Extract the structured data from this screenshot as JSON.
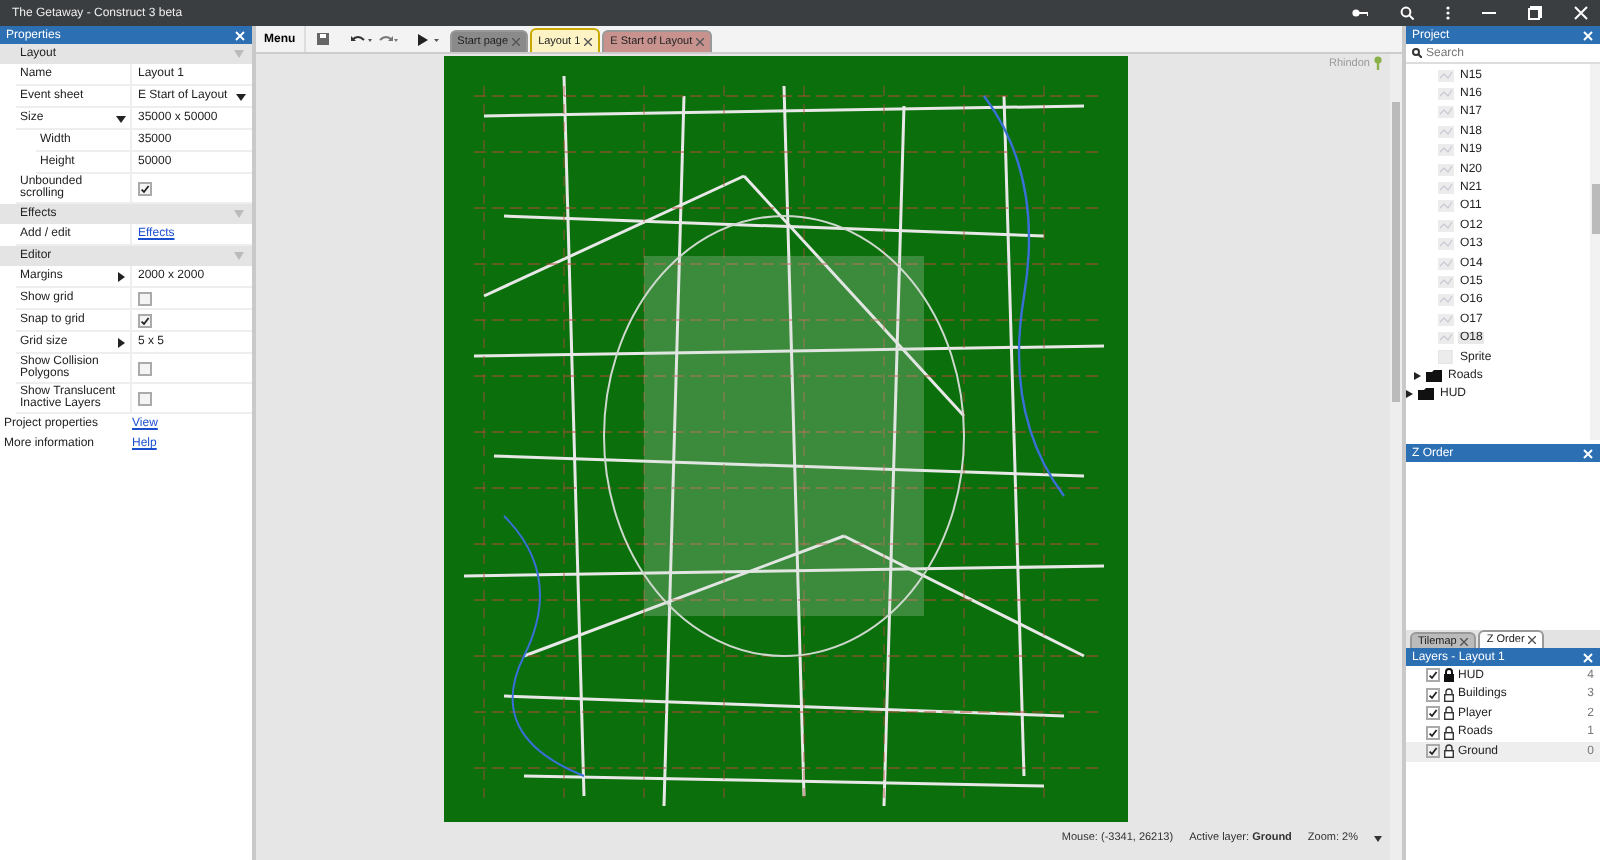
{
  "window": {
    "title": "The Getaway - Construct 3 beta"
  },
  "properties": {
    "title": "Properties",
    "sections": [
      {
        "title": "Layout",
        "rows": [
          {
            "label": "Name",
            "kind": "text",
            "value": "Layout 1"
          },
          {
            "label": "Event sheet",
            "kind": "dropdown",
            "value": "E Start of Layout"
          },
          {
            "label": "Size",
            "kind": "group",
            "value": "35000 x 50000",
            "expanded": true,
            "children": [
              {
                "label": "Width",
                "kind": "text",
                "value": "35000"
              },
              {
                "label": "Height",
                "kind": "text",
                "value": "50000"
              }
            ]
          },
          {
            "label": "Unbounded scrolling",
            "kind": "check",
            "checked": true
          }
        ]
      },
      {
        "title": "Effects",
        "rows": [
          {
            "label": "Add / edit",
            "kind": "link",
            "value": "Effects"
          }
        ]
      },
      {
        "title": "Editor",
        "rows": [
          {
            "label": "Margins",
            "kind": "group",
            "value": "2000 x 2000",
            "expanded": false
          },
          {
            "label": "Show grid",
            "kind": "check",
            "checked": false
          },
          {
            "label": "Snap to grid",
            "kind": "check",
            "checked": true
          },
          {
            "label": "Grid size",
            "kind": "group",
            "value": "5 x 5",
            "expanded": false
          },
          {
            "label": "Show Collision Polygons",
            "kind": "check",
            "checked": false
          },
          {
            "label": "Show Translucent Inactive Layers",
            "kind": "check",
            "checked": false
          }
        ]
      }
    ],
    "footer": [
      {
        "label": "Project properties",
        "link": "View"
      },
      {
        "label": "More information",
        "link": "Help"
      }
    ]
  },
  "toolbar": {
    "menu": "Menu"
  },
  "tabs": [
    {
      "label": "Start page",
      "selected": false,
      "color": "#8a8a8a"
    },
    {
      "label": "Layout 1",
      "selected": true,
      "color": "#fdf3c4"
    },
    {
      "label": "E Start of Layout",
      "selected": false,
      "color": "#c8938f"
    }
  ],
  "user": {
    "name": "Rhindon"
  },
  "status_bar": {
    "mouse": "Mouse: (-3341, 26213)",
    "layer": "Active layer: **Ground**",
    "zoom": "Zoom: 2%"
  },
  "project": {
    "title": "Project",
    "search": {
      "placeholder": "Search"
    },
    "tree": [
      {
        "children": [
          {
            "children": [
              {
                "label": "N15",
                "kind": "image",
                "selected": false
              },
              {
                "label": "N16",
                "kind": "image",
                "selected": false
              },
              {
                "label": "N17",
                "kind": "image",
                "selected": false
              },
              {
                "label": "N18",
                "kind": "image",
                "selected": false
              },
              {
                "label": "N19",
                "kind": "image",
                "selected": false
              },
              {
                "label": "N20",
                "kind": "image",
                "selected": false
              },
              {
                "label": "N21",
                "kind": "image",
                "selected": false
              },
              {
                "label": "O11",
                "kind": "image",
                "selected": false
              },
              {
                "label": "O12",
                "kind": "image",
                "selected": false
              },
              {
                "label": "O13",
                "kind": "image",
                "selected": false
              },
              {
                "label": "O14",
                "kind": "image",
                "selected": false
              },
              {
                "label": "O15",
                "kind": "image",
                "selected": false
              },
              {
                "label": "O16",
                "kind": "image",
                "selected": false
              },
              {
                "label": "O17",
                "kind": "image",
                "selected": false
              },
              {
                "label": "O18",
                "kind": "image",
                "selected": true
              },
              {
                "label": "Sprite",
                "kind": "sprite",
                "selected": false
              }
            ]
          },
          {
            "label": "Roads",
            "kind": "folder",
            "expanded": false,
            "selected": false
          }
        ]
      },
      {
        "label": "HUD",
        "kind": "folder",
        "expanded": false,
        "selected": false
      }
    ]
  },
  "zorder": {
    "title": "Z Order"
  },
  "bottom_tabs": [
    {
      "label": "Tilemap",
      "selected": false
    },
    {
      "label": "Z Order",
      "selected": true
    }
  ],
  "layers": {
    "title": "Layers - Layout 1",
    "items": [
      {
        "name": "HUD",
        "visible": true,
        "locked": true,
        "index": "4",
        "selected": false
      },
      {
        "name": "Buildings",
        "visible": true,
        "locked": false,
        "index": "3",
        "selected": false
      },
      {
        "name": "Player",
        "visible": true,
        "locked": false,
        "index": "2",
        "selected": false
      },
      {
        "name": "Roads",
        "visible": true,
        "locked": false,
        "index": "1",
        "selected": false
      },
      {
        "name": "Ground",
        "visible": true,
        "locked": false,
        "index": "0",
        "selected": true
      }
    ]
  }
}
